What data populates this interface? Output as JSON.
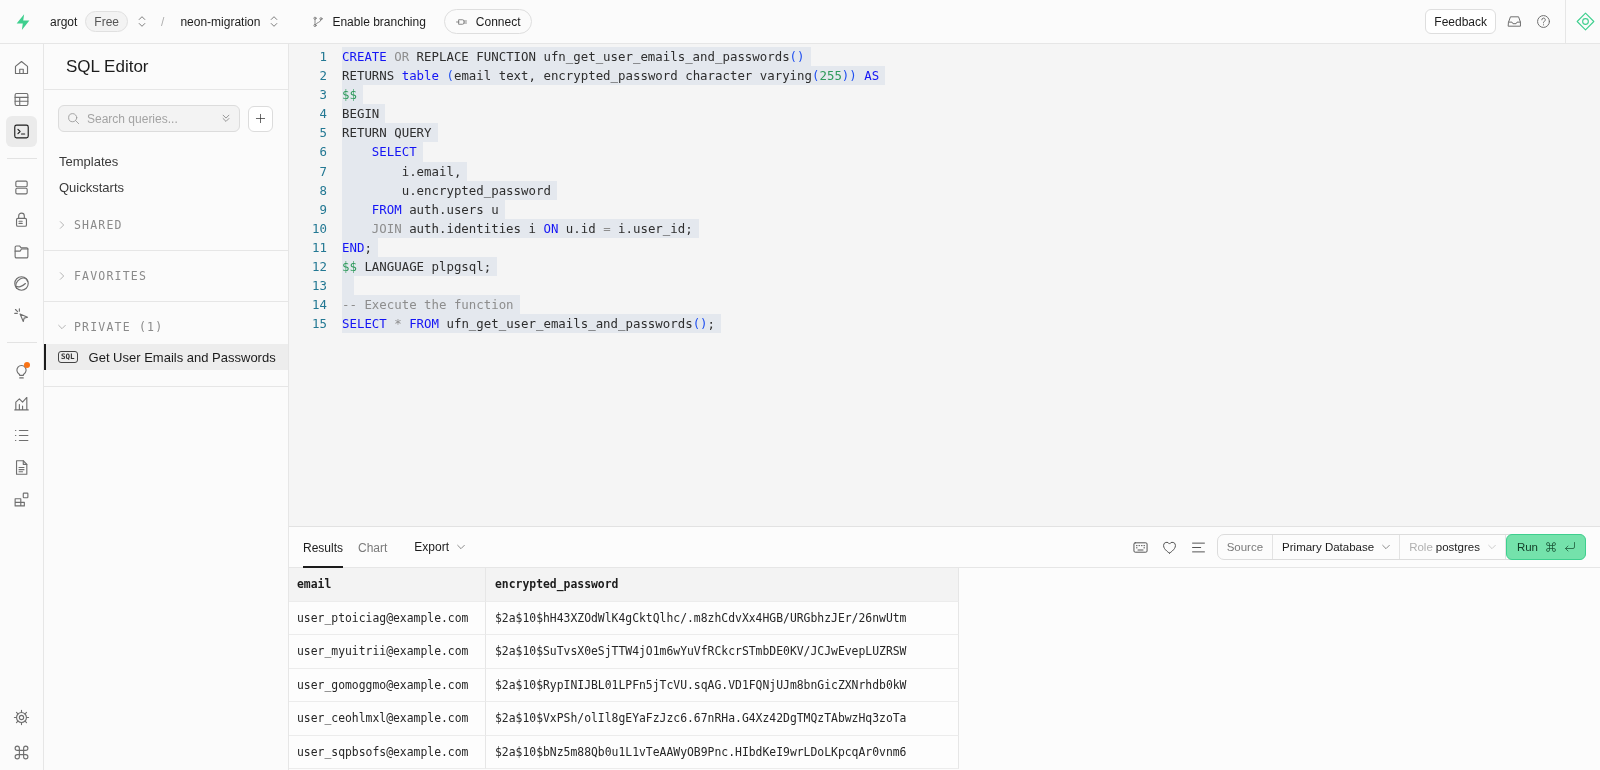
{
  "topbar": {
    "org": "argot",
    "plan": "Free",
    "separator": "/",
    "project": "neon-migration",
    "branching": "Enable branching",
    "connect": "Connect",
    "feedback": "Feedback"
  },
  "rail": {
    "groups": [
      {
        "items": [
          {
            "kind": "home",
            "selected": false,
            "notification": false
          },
          {
            "kind": "table",
            "selected": false,
            "notification": false
          },
          {
            "kind": "terminal",
            "selected": true,
            "notification": false
          }
        ]
      },
      {
        "items": [
          {
            "kind": "database",
            "selected": false,
            "notification": false
          },
          {
            "kind": "lock",
            "selected": false,
            "notification": false
          },
          {
            "kind": "folder",
            "selected": false,
            "notification": false
          },
          {
            "kind": "orbit",
            "selected": false,
            "notification": false
          },
          {
            "kind": "cursor",
            "selected": false,
            "notification": false
          }
        ]
      },
      {
        "items": [
          {
            "kind": "bulb",
            "selected": false,
            "notification": true
          },
          {
            "kind": "chart",
            "selected": false,
            "notification": false
          },
          {
            "kind": "list",
            "selected": false,
            "notification": false
          },
          {
            "kind": "document",
            "selected": false,
            "notification": false
          },
          {
            "kind": "blocks",
            "selected": false,
            "notification": false
          }
        ]
      }
    ],
    "bottom": [
      {
        "kind": "gear",
        "selected": false,
        "notification": false
      },
      {
        "kind": "command",
        "selected": false,
        "notification": false
      }
    ]
  },
  "panel": {
    "title": "SQL Editor",
    "search": {
      "placeholder": "Search queries..."
    },
    "links": [
      "Templates",
      "Quickstarts"
    ],
    "sections": [
      {
        "label": "SHARED",
        "expanded": false
      },
      {
        "label": "FAVORITES",
        "expanded": false
      },
      {
        "label": "PRIVATE (1)",
        "expanded": true,
        "items": [
          {
            "tag": "SQL",
            "label": "Get User Emails and Passwords",
            "selected": true
          }
        ]
      }
    ]
  },
  "editor": {
    "lines": [
      {
        "number": "1",
        "tokens": [
          {
            "kind": "keyword",
            "text": "CREATE"
          },
          {
            "kind": "muted",
            "text": " OR "
          },
          {
            "kind": "plain",
            "text": "REPLACE FUNCTION ufn_get_user_emails_and_passwords"
          },
          {
            "kind": "bracket",
            "text": "()"
          }
        ]
      },
      {
        "number": "2",
        "tokens": [
          {
            "kind": "plain",
            "text": "RETURNS "
          },
          {
            "kind": "keyword",
            "text": "table"
          },
          {
            "kind": "bracket",
            "text": " ("
          },
          {
            "kind": "plain",
            "text": "email text, encrypted_password character varying"
          },
          {
            "kind": "bracket",
            "text": "("
          },
          {
            "kind": "literal",
            "text": "255"
          },
          {
            "kind": "bracket",
            "text": "))"
          },
          {
            "kind": "keyword",
            "text": " AS"
          }
        ]
      },
      {
        "number": "3",
        "tokens": [
          {
            "kind": "literal",
            "text": "$$"
          }
        ]
      },
      {
        "number": "4",
        "tokens": [
          {
            "kind": "plain",
            "text": "BEGIN"
          }
        ]
      },
      {
        "number": "5",
        "tokens": [
          {
            "kind": "plain",
            "text": "RETURN QUERY"
          }
        ]
      },
      {
        "number": "6",
        "tokens": [
          {
            "kind": "keyword",
            "text": "    SELECT"
          }
        ]
      },
      {
        "number": "7",
        "tokens": [
          {
            "kind": "plain",
            "text": "        i.email,"
          }
        ]
      },
      {
        "number": "8",
        "tokens": [
          {
            "kind": "plain",
            "text": "        u.encrypted_password"
          }
        ]
      },
      {
        "number": "9",
        "tokens": [
          {
            "kind": "keyword",
            "text": "    FROM"
          },
          {
            "kind": "plain",
            "text": " auth.users u"
          }
        ]
      },
      {
        "number": "10",
        "tokens": [
          {
            "kind": "muted",
            "text": "    JOIN"
          },
          {
            "kind": "plain",
            "text": " auth.identities i "
          },
          {
            "kind": "keyword",
            "text": "ON"
          },
          {
            "kind": "plain",
            "text": " u.id "
          },
          {
            "kind": "muted",
            "text": "="
          },
          {
            "kind": "plain",
            "text": " i.user_id;"
          }
        ]
      },
      {
        "number": "11",
        "tokens": [
          {
            "kind": "keyword",
            "text": "END"
          },
          {
            "kind": "plain",
            "text": ";"
          }
        ]
      },
      {
        "number": "12",
        "tokens": [
          {
            "kind": "literal",
            "text": "$$"
          },
          {
            "kind": "plain",
            "text": " LANGUAGE plpgsql;"
          }
        ]
      },
      {
        "number": "13"
      },
      {
        "number": "14",
        "tokens": [
          {
            "kind": "comment",
            "text": "-- Execute the function"
          }
        ]
      },
      {
        "number": "15",
        "tokens": [
          {
            "kind": "keyword",
            "text": "SELECT"
          },
          {
            "kind": "muted",
            "text": " * "
          },
          {
            "kind": "keyword",
            "text": "FROM"
          },
          {
            "kind": "plain",
            "text": " ufn_get_user_emails_and_passwords"
          },
          {
            "kind": "bracket",
            "text": "()"
          },
          {
            "kind": "plain",
            "text": ";"
          }
        ]
      }
    ]
  },
  "results": {
    "tabs": [
      {
        "label": "Results",
        "selected": true
      },
      {
        "label": "Chart",
        "selected": false
      }
    ],
    "export": "Export",
    "source": "Source",
    "database": "Primary Database",
    "role_label": "Role",
    "role": "postgres",
    "run": "Run",
    "table": {
      "columns": [
        "email",
        "encrypted_password"
      ],
      "rows": [
        [
          "user_ptoiciag@example.com",
          "$2a$10$hH43XZOdWlK4gCktQlhc/.m8zhCdvXx4HGB/URGbhzJEr/26nwUtm"
        ],
        [
          "user_myuitrii@example.com",
          "$2a$10$SuTvsX0eSjTTW4jO1m6wYuVfRCkcrSTmbDE0KV/JCJwEvepLUZRSW"
        ],
        [
          "user_gomoggmo@example.com",
          "$2a$10$RypINIJBL01LPFn5jTcVU.sqAG.VD1FQNjUJm8bnGicZXNrhdb0kW"
        ],
        [
          "user_ceohlmxl@example.com",
          "$2a$10$VxPSh/olIl8gEYaFzJzc6.67nRHa.G4Xz42DgTMQzTAbwzHq3zoTa"
        ],
        [
          "user_sqpbsofs@example.com",
          "$2a$10$bNz5m88Qb0u1L1vTeAAWyOB9Pnc.HIbdKeI9wrLDoLKpcqAr0vnm6"
        ]
      ]
    }
  }
}
